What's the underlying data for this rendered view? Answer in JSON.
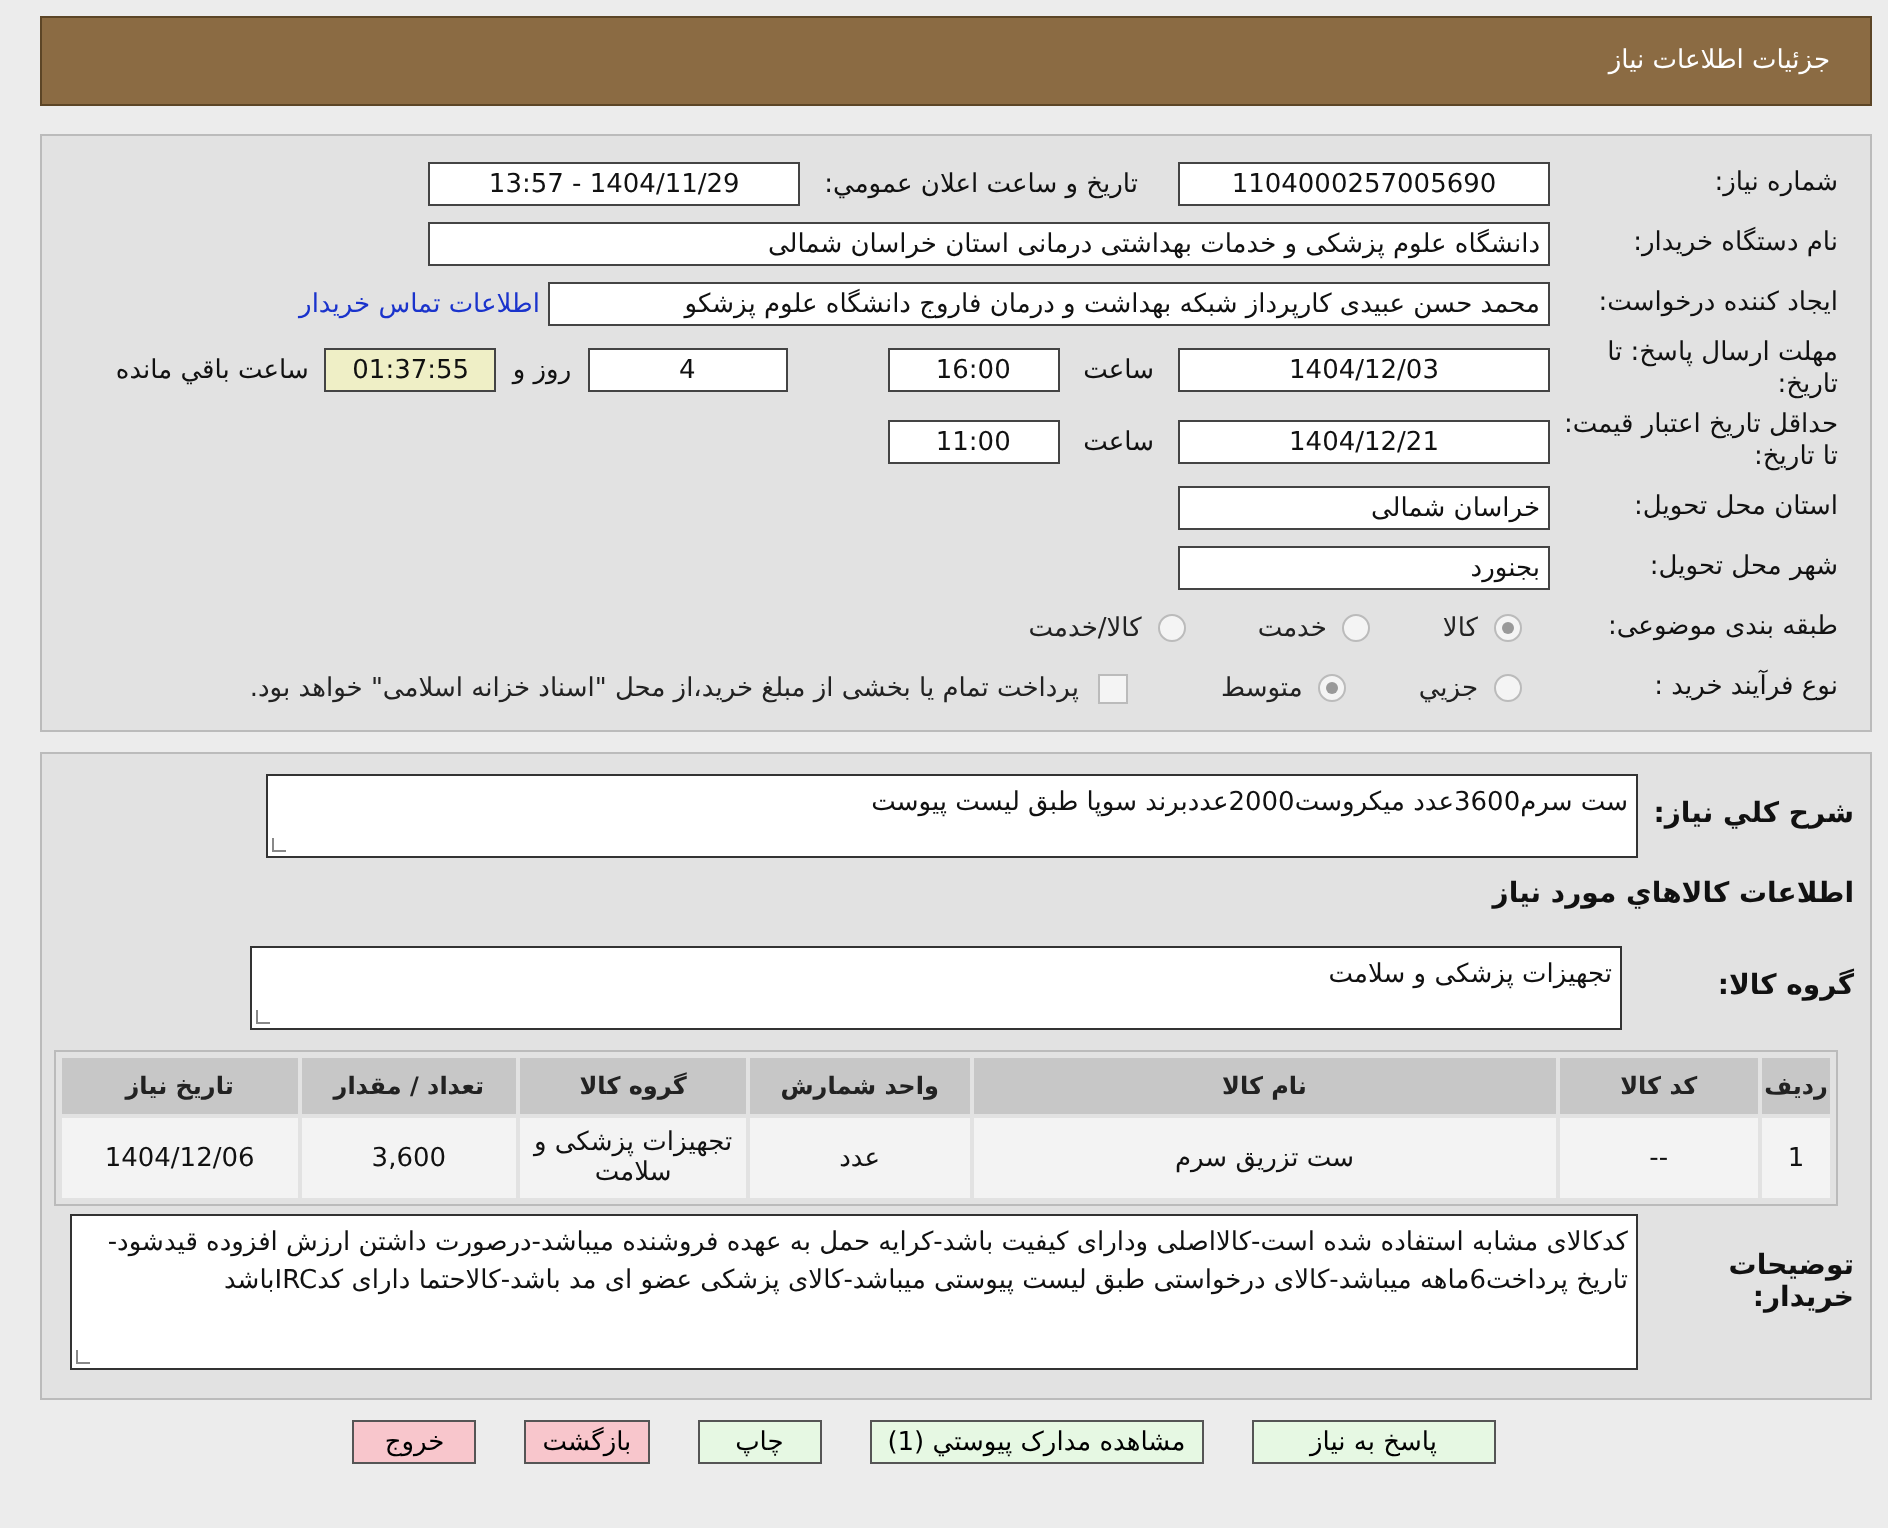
{
  "header": {
    "title": "جزئیات اطلاعات نیاز"
  },
  "need_number": {
    "label": "شماره نیاز:",
    "value": "1104000257005690"
  },
  "announce": {
    "label": "تاریخ و ساعت اعلان عمومي:",
    "value": "1404/11/29 - 13:57"
  },
  "buyer": {
    "label": "نام دستگاه خریدار:",
    "value": "دانشگاه علوم پزشکی و خدمات بهداشتی درمانی استان خراسان شمالی"
  },
  "creator": {
    "label": "ایجاد کننده درخواست:",
    "value": "محمد حسن عبیدی کارپرداز شبکه بهداشت و درمان فاروج دانشگاه علوم پزشکو",
    "link": "اطلاعات تماس خریدار"
  },
  "deadline": {
    "label": "مهلت ارسال پاسخ: تا تاریخ:",
    "date": "1404/12/03",
    "time_label": "ساعت",
    "time": "16:00",
    "days": "4",
    "days_label": "روز و",
    "remaining": "01:37:55",
    "remaining_label": "ساعت باقي مانده"
  },
  "validity": {
    "label": "حداقل تاریخ اعتبار قیمت: تا تاریخ:",
    "date": "1404/12/21",
    "time_label": "ساعت",
    "time": "11:00"
  },
  "province": {
    "label": "استان محل تحویل:",
    "value": "خراسان شمالی"
  },
  "city": {
    "label": "شهر محل تحویل:",
    "value": "بجنورد"
  },
  "category": {
    "label": "طبقه بندی موضوعی:",
    "options": [
      {
        "label": "کالا",
        "selected": true
      },
      {
        "label": "خدمت",
        "selected": false
      },
      {
        "label": "کالا/خدمت",
        "selected": false
      }
    ]
  },
  "process": {
    "label": "نوع فرآیند خرید :",
    "options": [
      {
        "label": "جزيي",
        "selected": false
      },
      {
        "label": "متوسط",
        "selected": true
      }
    ],
    "checkbox": {
      "label": "پرداخت تمام یا بخشی از مبلغ خرید،از محل \"اسناد خزانه اسلامی\" خواهد بود.",
      "checked": false
    }
  },
  "description": {
    "label": "شرح کلي نیاز:",
    "value": "ست سرم3600عدد میکروست2000عددبرند سوپا طبق لیست پیوست"
  },
  "goods_heading": "اطلاعات کالاهاي مورد نیاز",
  "goods_group": {
    "label": "گروه کالا:",
    "value": "تجهیزات پزشکی و سلامت"
  },
  "table": {
    "columns": [
      "ردیف",
      "کد کالا",
      "نام کالا",
      "واحد شمارش",
      "گروه کالا",
      "تعداد / مقدار",
      "تاریخ نیاز"
    ],
    "rows": [
      [
        "1",
        "--",
        "ست تزریق سرم",
        "عدد",
        "تجهیزات پزشکی و سلامت",
        "3,600",
        "1404/12/06"
      ]
    ]
  },
  "notes": {
    "label": "توضیحات خریدار:",
    "value": "کدکالای مشابه استفاده شده است-کالااصلی ودارای کیفیت باشد-کرایه حمل به عهده فروشنده میباشد-درصورت داشتن ارزش افزوده قیدشود-تاریخ پرداخت6ماهه میباشد-کالای درخواستی طبق لیست پیوستی میباشد-کالای پزشکی عضو ای مد باشد-کالاحتما دارای کدIRCباشد"
  },
  "buttons": [
    {
      "label": "پاسخ به نیاز",
      "kind": "primary"
    },
    {
      "label": "مشاهده مدارک پیوستي (1)",
      "kind": "primary"
    },
    {
      "label": "چاپ",
      "kind": "primary"
    },
    {
      "label": "بازگشت",
      "kind": "danger"
    },
    {
      "label": "خروج",
      "kind": "danger"
    }
  ]
}
